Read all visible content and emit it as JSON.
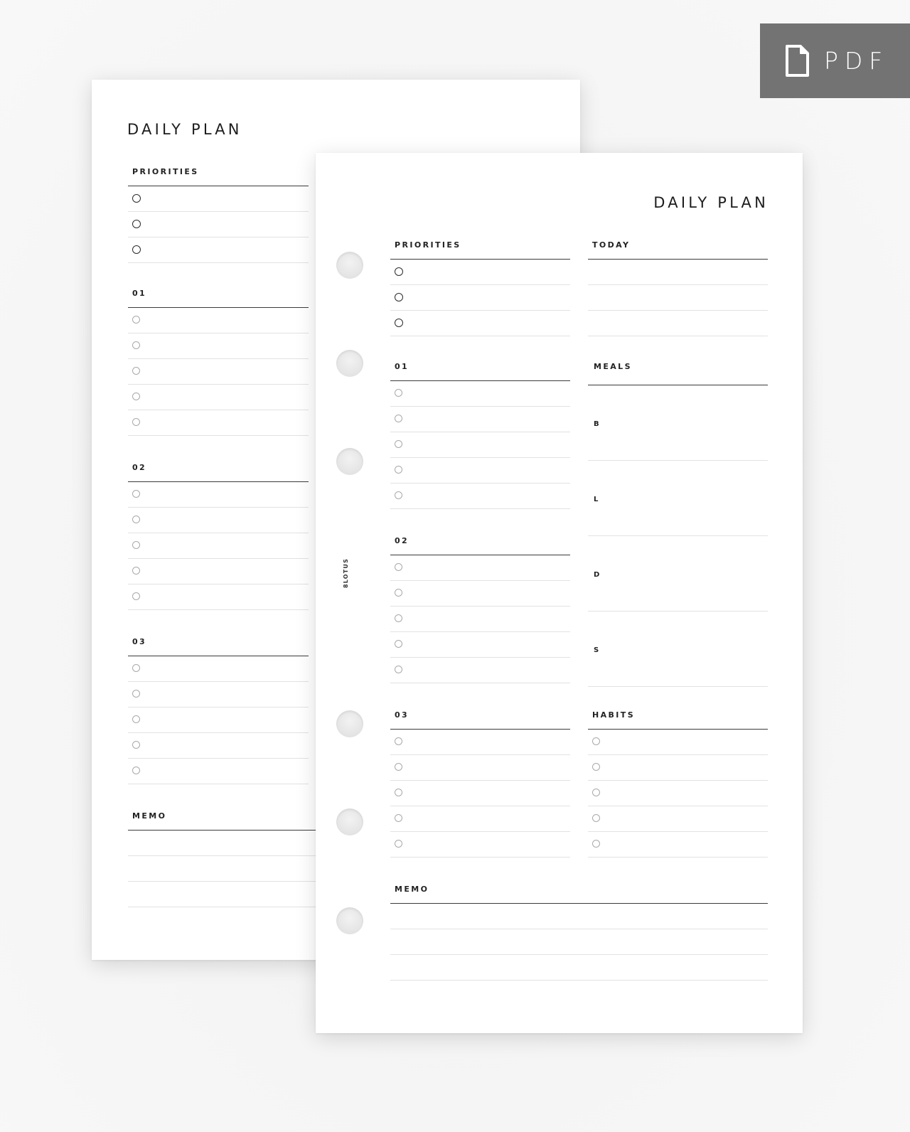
{
  "badge": {
    "label": "PDF",
    "icon": "document-icon",
    "background": "#737373"
  },
  "back_page": {
    "title": "DAILY PLAN",
    "sections": [
      {
        "label": "PRIORITIES",
        "rows": 3,
        "checkbox_style": "dark"
      },
      {
        "label": "01",
        "rows": 5,
        "checkbox_style": "light"
      },
      {
        "label": "02",
        "rows": 5,
        "checkbox_style": "light"
      },
      {
        "label": "03",
        "rows": 5,
        "checkbox_style": "light"
      },
      {
        "label": "MEMO",
        "rows": 3,
        "checkbox_style": "none"
      }
    ]
  },
  "front_page": {
    "title": "DAILY PLAN",
    "brand": "8LOTUS",
    "punch_holes": 6,
    "left_column": [
      {
        "label": "PRIORITIES",
        "rows": 3,
        "checkbox_style": "dark"
      },
      {
        "label": "01",
        "rows": 5,
        "checkbox_style": "light"
      },
      {
        "label": "02",
        "rows": 5,
        "checkbox_style": "light"
      },
      {
        "label": "03",
        "rows": 5,
        "checkbox_style": "light"
      }
    ],
    "right_column": {
      "today": {
        "label": "TODAY",
        "rows": 3
      },
      "meals": {
        "label": "MEALS",
        "items": [
          "B",
          "L",
          "D",
          "S"
        ]
      },
      "habits": {
        "label": "HABITS",
        "rows": 5
      }
    },
    "memo": {
      "label": "MEMO",
      "rows": 3
    }
  }
}
